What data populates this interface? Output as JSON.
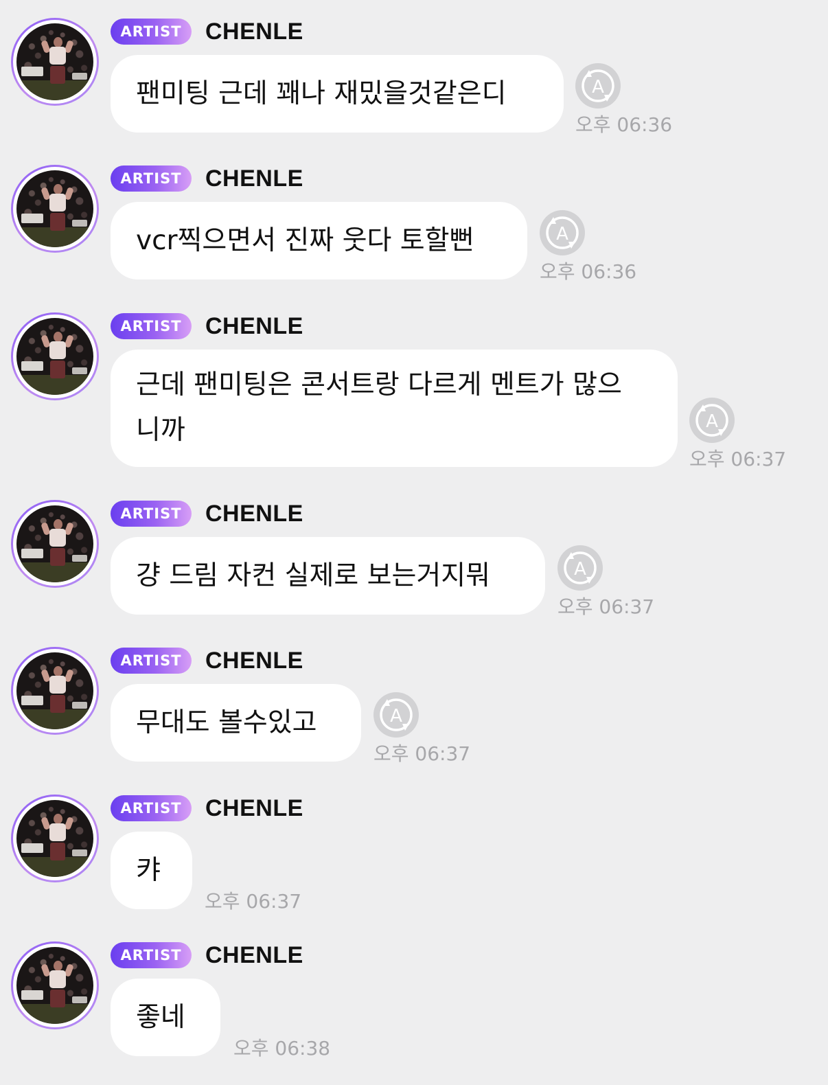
{
  "badge_label": "ARTIST",
  "sender_name": "CHENLE",
  "messages": [
    {
      "text": "팬미팅 근데 꽤나 재밌을것같은디",
      "time": "오후 06:36",
      "auto_translate": true
    },
    {
      "text": "vcr찍으면서 진짜 웃다 토할뻔",
      "time": "오후 06:36",
      "auto_translate": true
    },
    {
      "text": "근데 팬미팅은 콘서트랑 다르게 멘트가 많으니까",
      "line1": "근데 팬미팅은 콘서트랑 다르게 멘트가 많으",
      "line2": "니까",
      "time": "오후 06:37",
      "auto_translate": true
    },
    {
      "text": "걍 드림 자컨 실제로 보는거지뭐",
      "time": "오후 06:37",
      "auto_translate": true
    },
    {
      "text": "무대도 볼수있고",
      "time": "오후 06:37",
      "auto_translate": true
    },
    {
      "text": "캬",
      "time": "오후 06:37",
      "auto_translate": false
    },
    {
      "text": "좋네",
      "time": "오후 06:38",
      "auto_translate": false
    }
  ],
  "icons": {
    "translate": "auto-translate-icon",
    "avatar": "profile-avatar"
  },
  "colors": {
    "background": "#eeeeef",
    "badge_start": "#6a3fef",
    "badge_end": "#d79ef6",
    "bubble": "#ffffff",
    "timestamp": "#a7a7aa",
    "icon": "#d2d2d4"
  }
}
